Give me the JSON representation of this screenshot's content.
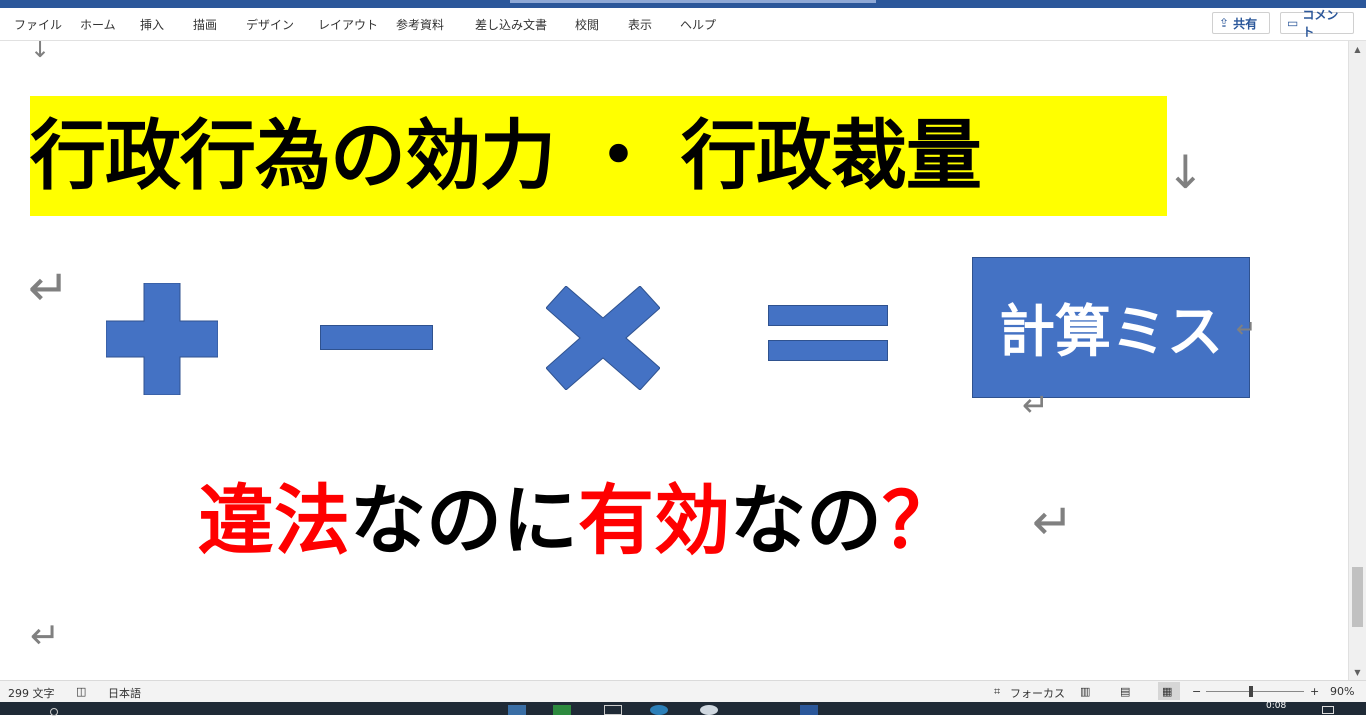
{
  "ribbon": {
    "tabs": [
      "ファイル",
      "ホーム",
      "挿入",
      "描画",
      "デザイン",
      "レイアウト",
      "参考資料",
      "差し込み文書",
      "校閲",
      "表示",
      "ヘルプ"
    ],
    "share_label": "共有",
    "comment_label": "コメント"
  },
  "document": {
    "title": "行政行為の効力 ・ 行政裁量",
    "calc_box_text": "計算ミス",
    "question": {
      "part1": "違法",
      "part2": "なのに",
      "part3": "有効",
      "part4": "なの",
      "part5": "？"
    },
    "shapes": [
      "plus",
      "minus",
      "multiply",
      "equals"
    ],
    "shape_color": "#4472c4",
    "highlight_color": "#ffff00",
    "accent_red": "#ff0000"
  },
  "status": {
    "word_count": "299 文字",
    "language": "日本語",
    "focus_label": "フォーカス",
    "zoom_minus": "−",
    "zoom_plus": "+",
    "zoom_level": "90%"
  },
  "taskbar": {
    "time": "0:08"
  }
}
